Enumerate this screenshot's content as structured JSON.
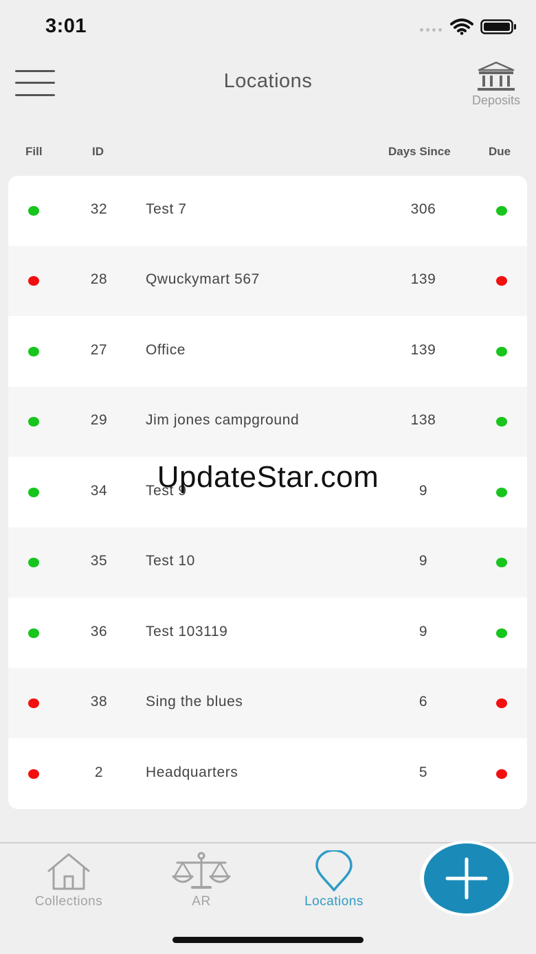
{
  "status_bar": {
    "time": "3:01",
    "wifi_icon": "wifi-icon",
    "battery_icon": "battery-icon"
  },
  "nav": {
    "title": "Locations",
    "menu_icon": "hamburger-menu-icon",
    "deposits": {
      "label": "Deposits",
      "icon": "bank-icon"
    }
  },
  "columns": {
    "fill": "Fill",
    "id": "ID",
    "days_since": "Days Since",
    "due": "Due"
  },
  "colors": {
    "green": "#17c51d",
    "red": "#f20f0f",
    "accent": "#1a8bb8",
    "tab_inactive": "#a3a3a3",
    "tab_active": "#2f9bc6"
  },
  "locations": [
    {
      "fill": "green",
      "id": "32",
      "name": "Test 7",
      "days": "306",
      "due": "green"
    },
    {
      "fill": "red",
      "id": "28",
      "name": "Qwuckymart 567",
      "days": "139",
      "due": "red"
    },
    {
      "fill": "green",
      "id": "27",
      "name": "Office",
      "days": "139",
      "due": "green"
    },
    {
      "fill": "green",
      "id": "29",
      "name": "Jim jones campground",
      "days": "138",
      "due": "green"
    },
    {
      "fill": "green",
      "id": "34",
      "name": "Test 9",
      "days": "9",
      "due": "green"
    },
    {
      "fill": "green",
      "id": "35",
      "name": "Test 10",
      "days": "9",
      "due": "green"
    },
    {
      "fill": "green",
      "id": "36",
      "name": "Test 103119",
      "days": "9",
      "due": "green"
    },
    {
      "fill": "red",
      "id": "38",
      "name": "Sing the blues",
      "days": "6",
      "due": "red"
    },
    {
      "fill": "red",
      "id": "2",
      "name": "Headquarters",
      "days": "5",
      "due": "red"
    }
  ],
  "watermark": "UpdateStar.com",
  "tabs": [
    {
      "label": "Collections",
      "icon": "home-icon",
      "active": false
    },
    {
      "label": "AR",
      "icon": "scale-icon",
      "active": false
    },
    {
      "label": "Locations",
      "icon": "map-pin-icon",
      "active": true
    }
  ],
  "fab": {
    "icon": "plus-icon"
  }
}
